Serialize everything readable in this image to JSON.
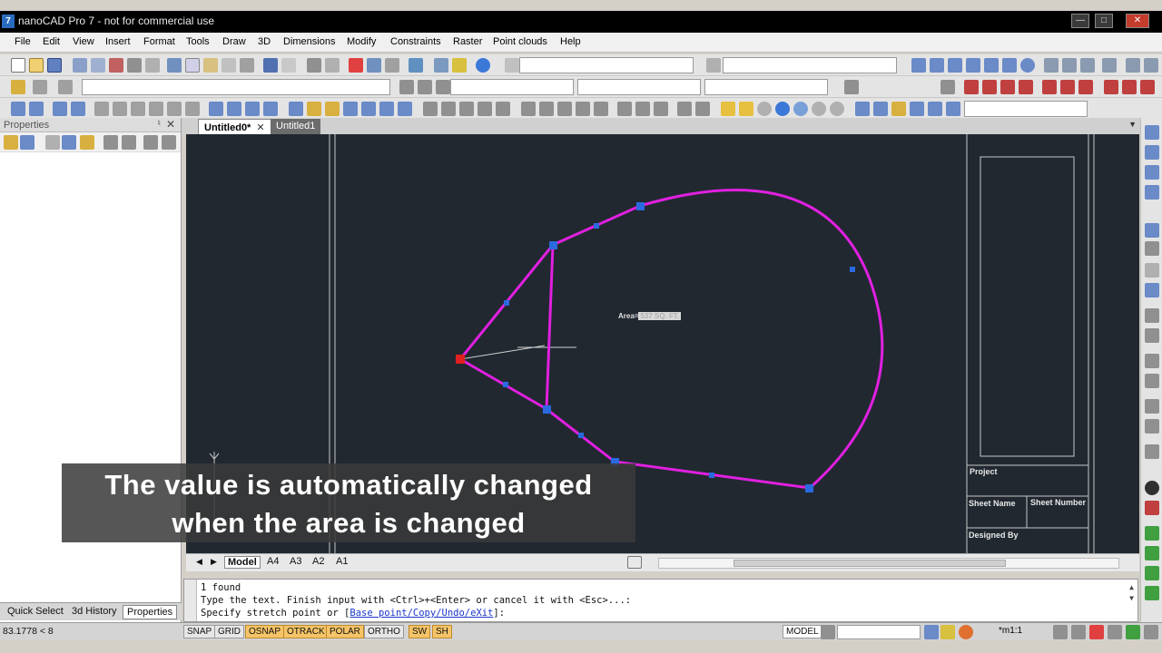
{
  "window": {
    "title": "nanoCAD Pro 7 - not for commercial use",
    "logo_letter": "7"
  },
  "menu": [
    "File",
    "Edit",
    "View",
    "Insert",
    "Format",
    "Tools",
    "Draw",
    "3D",
    "Dimensions",
    "Modify",
    "Constraints",
    "Raster",
    "Point clouds",
    "Help"
  ],
  "properties_panel": {
    "title": "Properties",
    "bottom_tabs": [
      "Quick Select",
      "3d History",
      "Properties"
    ],
    "active_tab": "Properties"
  },
  "doc_tabs": [
    {
      "label": "Untitled0*",
      "active": true
    },
    {
      "label": "Untitled1",
      "active": false
    }
  ],
  "drawing": {
    "area_label_prefix": "Area=",
    "area_label_value": "537 SQ. FT.",
    "title_block": {
      "project": "Project",
      "sheet_name": "Sheet Name",
      "sheet_number": "Sheet Number",
      "designed_by": "Designed By"
    },
    "colors": {
      "background": "#212830",
      "shape": "#e020e0",
      "grips": "#2a6ae0",
      "active_grip": "#e02020"
    }
  },
  "layout_tabs": [
    "Model",
    "A4",
    "A3",
    "A2",
    "A1"
  ],
  "active_layout": "Model",
  "command_line": {
    "line1": "1 found",
    "line2": "Type the text. Finish input with <Ctrl>+<Enter> or cancel it with <Esc>...:",
    "line3_prefix": "Specify stretch point or [",
    "line3_options": "Base point/Copy/Undo/eXit",
    "line3_suffix": "]:"
  },
  "status_bar": {
    "coords": "83.1778 < 8",
    "toggles": [
      {
        "label": "SNAP",
        "on": false
      },
      {
        "label": "GRID",
        "on": false
      },
      {
        "label": "OSNAP",
        "on": true
      },
      {
        "label": "OTRACK",
        "on": true
      },
      {
        "label": "POLAR",
        "on": true
      },
      {
        "label": "ORTHO",
        "on": false
      },
      {
        "label": "SW",
        "on": true
      },
      {
        "label": "SH",
        "on": true
      }
    ],
    "space": "MODEL",
    "scale": "*m1:1"
  },
  "caption": {
    "line1": "The value is automatically changed",
    "line2": "when the area is changed"
  }
}
